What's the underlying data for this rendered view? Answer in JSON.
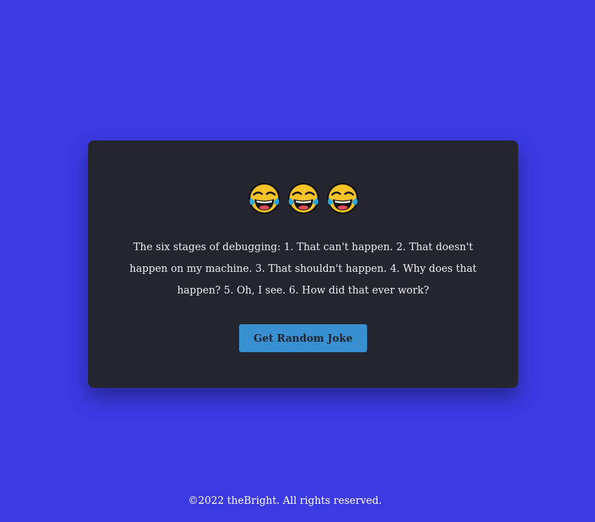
{
  "card": {
    "emojis": [
      "laughing-tears",
      "laughing-tears",
      "laughing-tears"
    ],
    "joke": "The six stages of debugging: 1. That can't happen. 2. That doesn't happen on my machine. 3. That shouldn't happen. 4. Why does that happen? 5. Oh, I see. 6. How did that ever work?",
    "button_label": "Get Random Joke"
  },
  "footer": {
    "text": "©2022 theBright. All rights reserved."
  },
  "colors": {
    "background": "#3b3ae3",
    "card": "#24252f",
    "button": "#3890d0",
    "joke_text": "#ececf2"
  }
}
